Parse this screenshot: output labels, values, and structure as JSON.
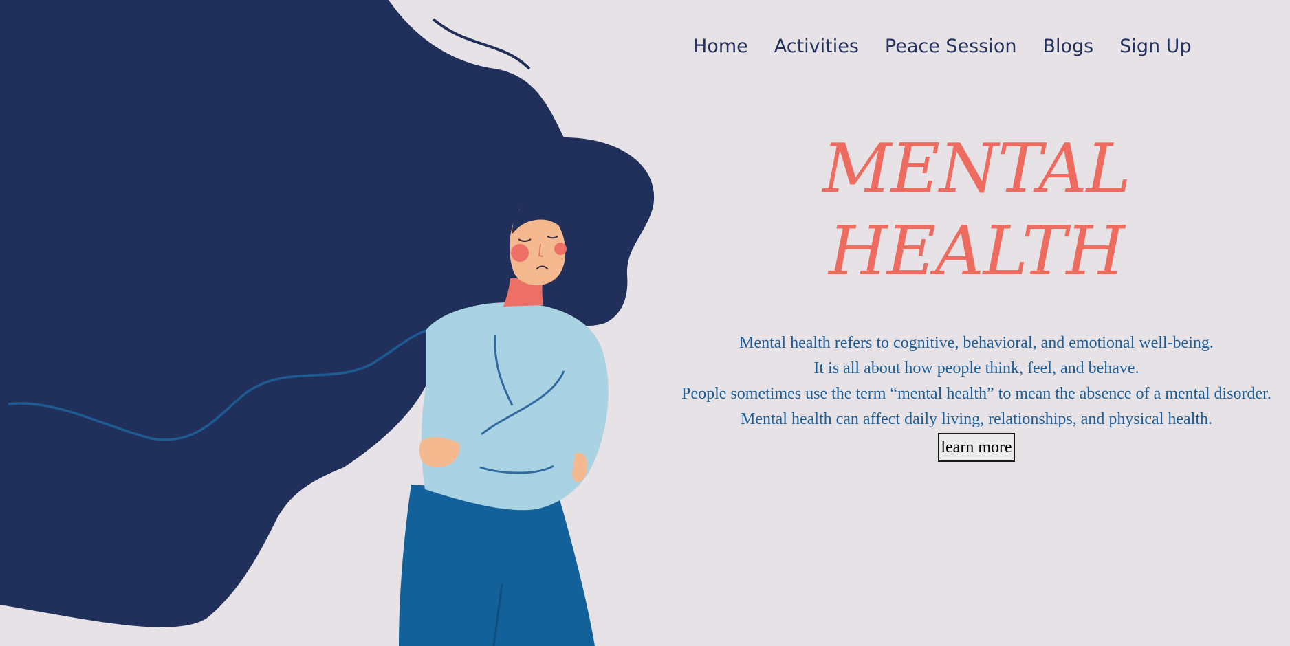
{
  "nav": {
    "items": [
      {
        "label": "Home"
      },
      {
        "label": "Activities"
      },
      {
        "label": "Peace Session"
      },
      {
        "label": "Blogs"
      },
      {
        "label": "Sign Up"
      }
    ]
  },
  "hero": {
    "title_line1": "MENTAL",
    "title_line2": "HEALTH",
    "description": [
      "Mental health refers to cognitive, behavioral, and emotional well-being.",
      "It is all about how people think, feel, and behave.",
      "People sometimes use the term “mental health” to mean the absence of a mental disorder.",
      "Mental health can affect daily living, relationships, and physical health."
    ],
    "button_label": "learn more"
  },
  "colors": {
    "background": "#e7e2e5",
    "nav_text": "#23325e",
    "title": "#ee6b5f",
    "body_text": "#1c5e98",
    "hair": "#21305b",
    "sweater": "#a9d3e2",
    "pants": "#12619a",
    "skin": "#f5b990",
    "cheeks": "#ed6f66"
  },
  "illustration": {
    "icon": "woman-with-flowing-hair-illustration"
  }
}
